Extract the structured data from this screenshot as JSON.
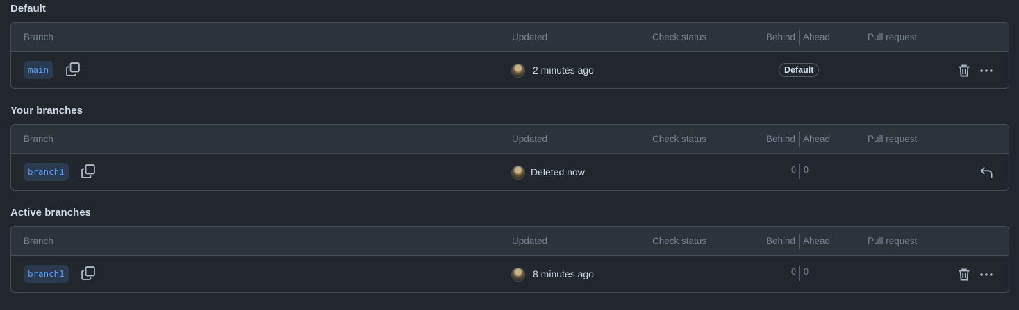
{
  "sections": [
    {
      "title": "Default",
      "columns": {
        "branch": "Branch",
        "updated": "Updated",
        "check_status": "Check status",
        "behind": "Behind",
        "ahead": "Ahead",
        "pull_request": "Pull request"
      },
      "row": {
        "branch": "main",
        "updated": "2 minutes ago",
        "badge": "Default",
        "actions": [
          "trash-icon",
          "kebab-menu-icon"
        ]
      }
    },
    {
      "title": "Your branches",
      "columns": {
        "branch": "Branch",
        "updated": "Updated",
        "check_status": "Check status",
        "behind": "Behind",
        "ahead": "Ahead",
        "pull_request": "Pull request"
      },
      "row": {
        "branch": "branch1",
        "updated": "Deleted now",
        "behind": "0",
        "ahead": "0",
        "actions": [
          "restore-icon"
        ]
      }
    },
    {
      "title": "Active branches",
      "columns": {
        "branch": "Branch",
        "updated": "Updated",
        "check_status": "Check status",
        "behind": "Behind",
        "ahead": "Ahead",
        "pull_request": "Pull request"
      },
      "row": {
        "branch": "branch1",
        "updated": "8 minutes ago",
        "behind": "0",
        "ahead": "0",
        "actions": [
          "trash-icon",
          "kebab-menu-icon"
        ]
      }
    }
  ],
  "colors": {
    "background": "#22272e",
    "header_background": "#2d333b",
    "border": "#444c56",
    "branch_chip_text": "#539bf5",
    "branch_chip_background": "#2b3a4e"
  }
}
